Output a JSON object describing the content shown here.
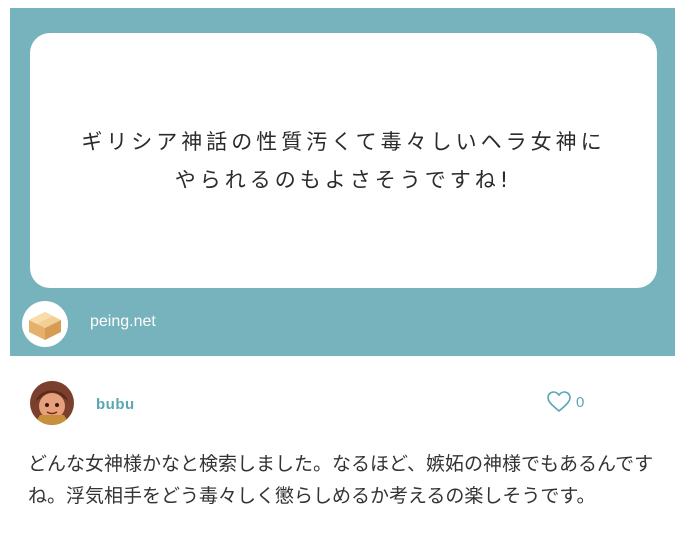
{
  "question": {
    "line1": "ギリシア神話の性質汚くて毒々しいヘラ女神に",
    "line2": "やられるのもよさそうですね!"
  },
  "source": {
    "name": "peing.net",
    "icon": "cardboard-box-icon"
  },
  "answer_post": {
    "username": "bubu",
    "avatar": "user-avatar",
    "likes": "0",
    "like_icon": "heart-outline-icon",
    "text": "どんな女神様かなと検索しました。なるほど、嫉妬の神様でもあるんですね。浮気相手をどう毒々しく懲らしめるか考えるの楽しそうです。"
  },
  "colors": {
    "card_background": "#76b3bc",
    "accent": "#5aa7b3",
    "text": "#333333"
  }
}
